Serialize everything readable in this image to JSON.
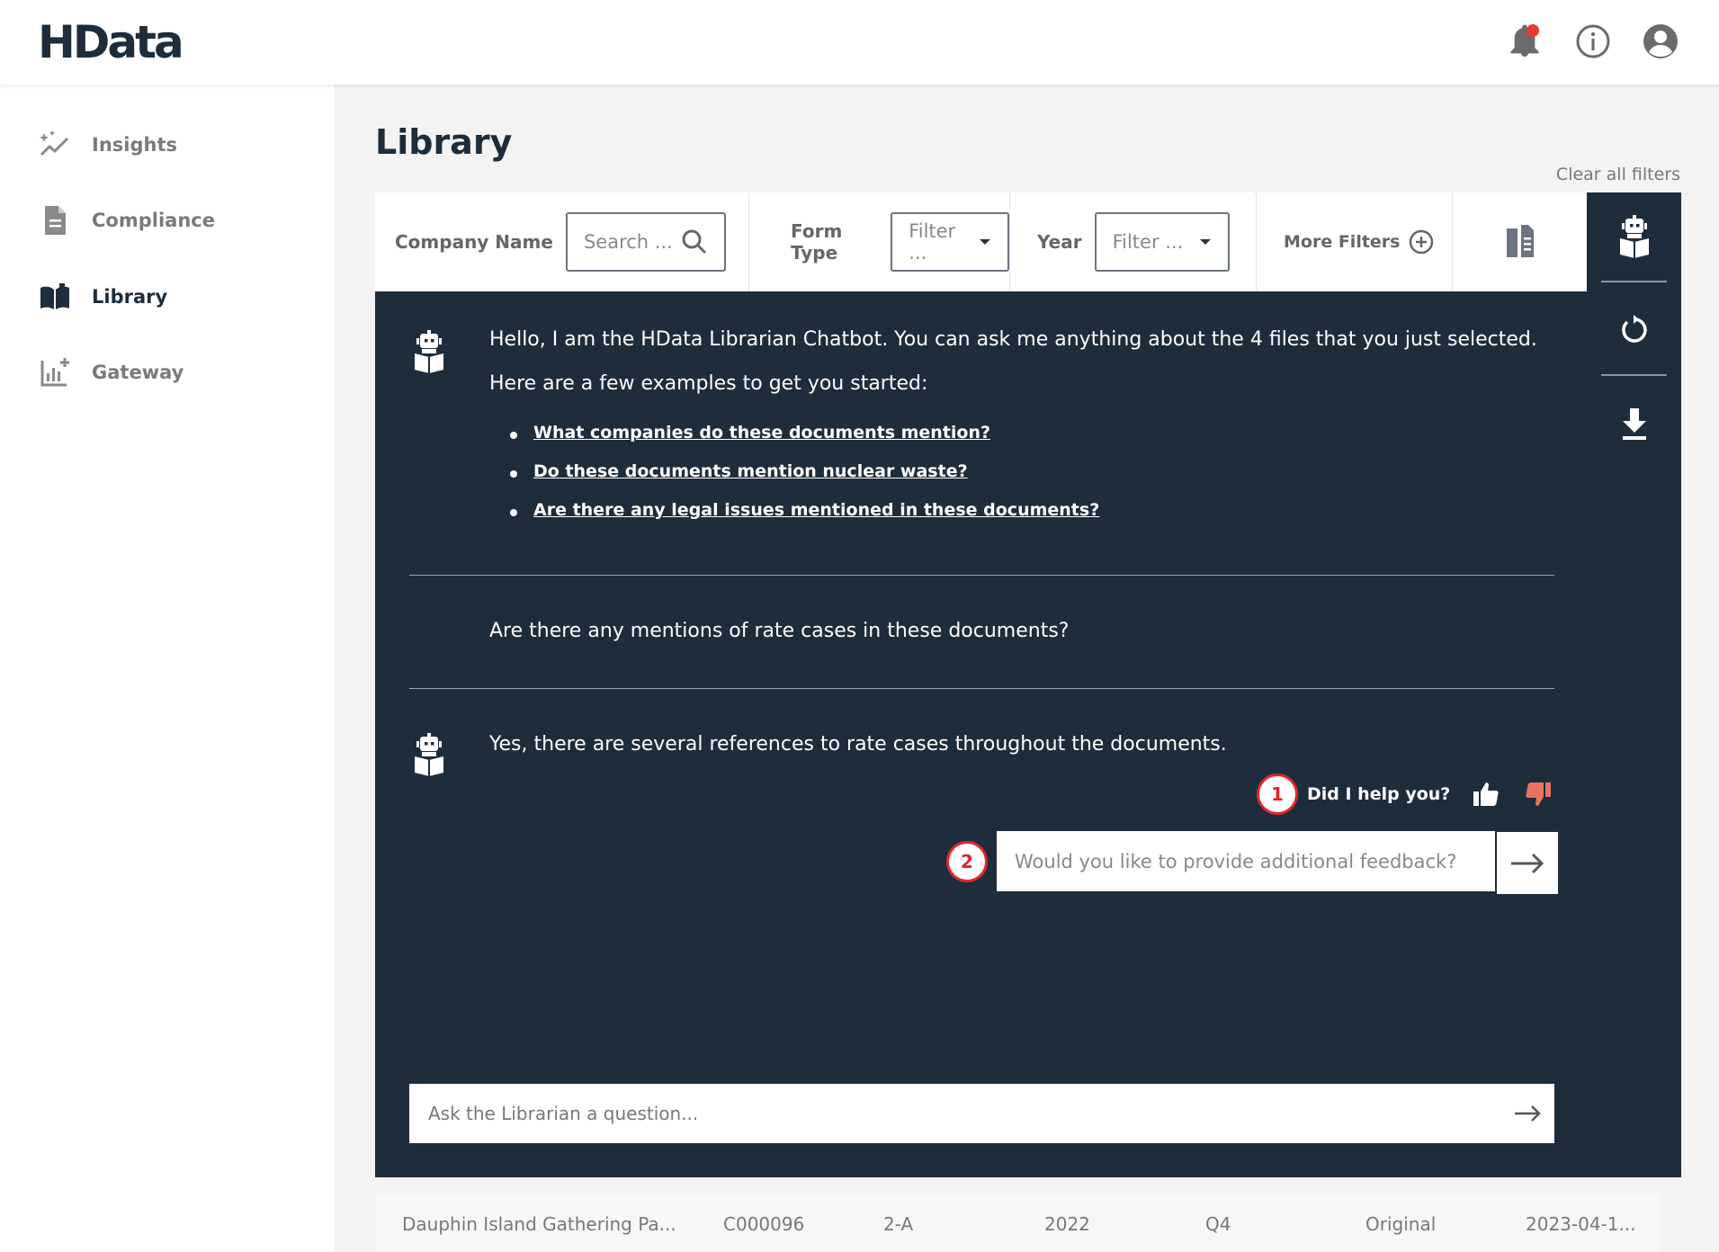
{
  "header": {
    "logo": "HData",
    "icons": [
      "bell-icon",
      "info-icon",
      "user-icon"
    ],
    "notification_dot_color": "#e83a2f"
  },
  "sidebar": {
    "items": [
      {
        "label": "Insights",
        "icon": "sparkle-chart-icon",
        "active": false
      },
      {
        "label": "Compliance",
        "icon": "document-icon",
        "active": false
      },
      {
        "label": "Library",
        "icon": "open-book-icon",
        "active": true
      },
      {
        "label": "Gateway",
        "icon": "chart-add-icon",
        "active": false
      }
    ]
  },
  "main": {
    "title": "Library",
    "clear_filters": "Clear all filters"
  },
  "filters": {
    "company": {
      "label": "Company Name",
      "placeholder": "Search ..."
    },
    "form_type": {
      "label": "Form Type",
      "placeholder": "Filter ..."
    },
    "year": {
      "label": "Year",
      "placeholder": "Filter ..."
    },
    "more": {
      "label": "More Filters"
    }
  },
  "chat": {
    "intro": "Hello, I am the HData Librarian Chatbot. You can ask me anything about the 4 files that you just selected.",
    "intro2": "Here are a few examples to get you started:",
    "examples": [
      "What companies do these documents mention?",
      "Do these documents mention nuclear waste?",
      "Are there any legal issues mentioned in these documents?"
    ],
    "user_question": "Are there any mentions of rate cases in these documents?",
    "bot_answer": "Yes, there are several references to rate cases throughout the documents.",
    "helpful_prompt": "Did I help you?",
    "marker_1": "1",
    "marker_2": "2",
    "feedback_placeholder": "Would you like to provide additional feedback?",
    "ask_placeholder": "Ask the Librarian a question..."
  },
  "table_row": {
    "company": "Dauphin Island Gathering Pa...",
    "id": "C000096",
    "form": "2-A",
    "year": "2022",
    "quarter": "Q4",
    "type": "Original",
    "date": "2023-04-1..."
  },
  "colors": {
    "navy": "#1e2d3b",
    "thumb_down": "#e8735f",
    "marker_red": "#e0262b"
  }
}
